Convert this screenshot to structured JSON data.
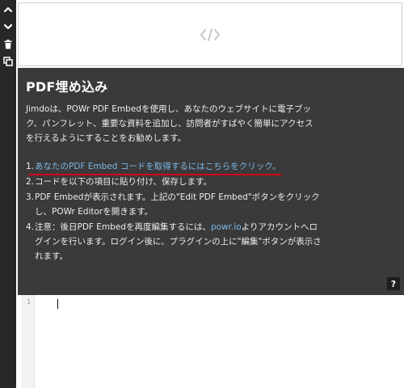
{
  "toolbar": {
    "icons": [
      "chevron-up-icon",
      "chevron-down-icon",
      "trash-icon",
      "copy-icon"
    ]
  },
  "preview": {
    "icon": "code-icon",
    "glyph": "</>"
  },
  "panel": {
    "title": "PDF埋め込み",
    "intro": "Jimdoは、POWr PDF Embedを使用し、あなたのウェブサイトに電子ブック、パンフレット、重要な資料を追加し、訪問者がすばやく簡単にアクセスを行えるようにすることをお勧めします。",
    "steps": [
      {
        "num": "1.",
        "link_text": "あなたのPDF Embed コードを取得するにはこちらをクリック。"
      },
      {
        "num": "2.",
        "text": "コードを以下の項目に貼り付け、保存します。"
      },
      {
        "num": "3.",
        "text": "PDF Embedが表示されます。上記の\"Edit PDF Embed\"ボタンをクリックし、POWr Editorを開きます。"
      },
      {
        "num": "4.",
        "text_before": "注意：後日PDF Embedを再度編集するには、",
        "link": "powr.io",
        "text_after": "よりアカウントへログインを行います。ログイン後に、プラグインの上に\"編集\"ボタンが表示されます。"
      }
    ],
    "help_label": "?"
  },
  "editor": {
    "line_number": "1",
    "value": ""
  },
  "colors": {
    "panel_bg": "#3a3a3a",
    "toolbar_bg": "#282828",
    "link": "#7cb8e8",
    "underline_annotation": "#d0021b"
  }
}
